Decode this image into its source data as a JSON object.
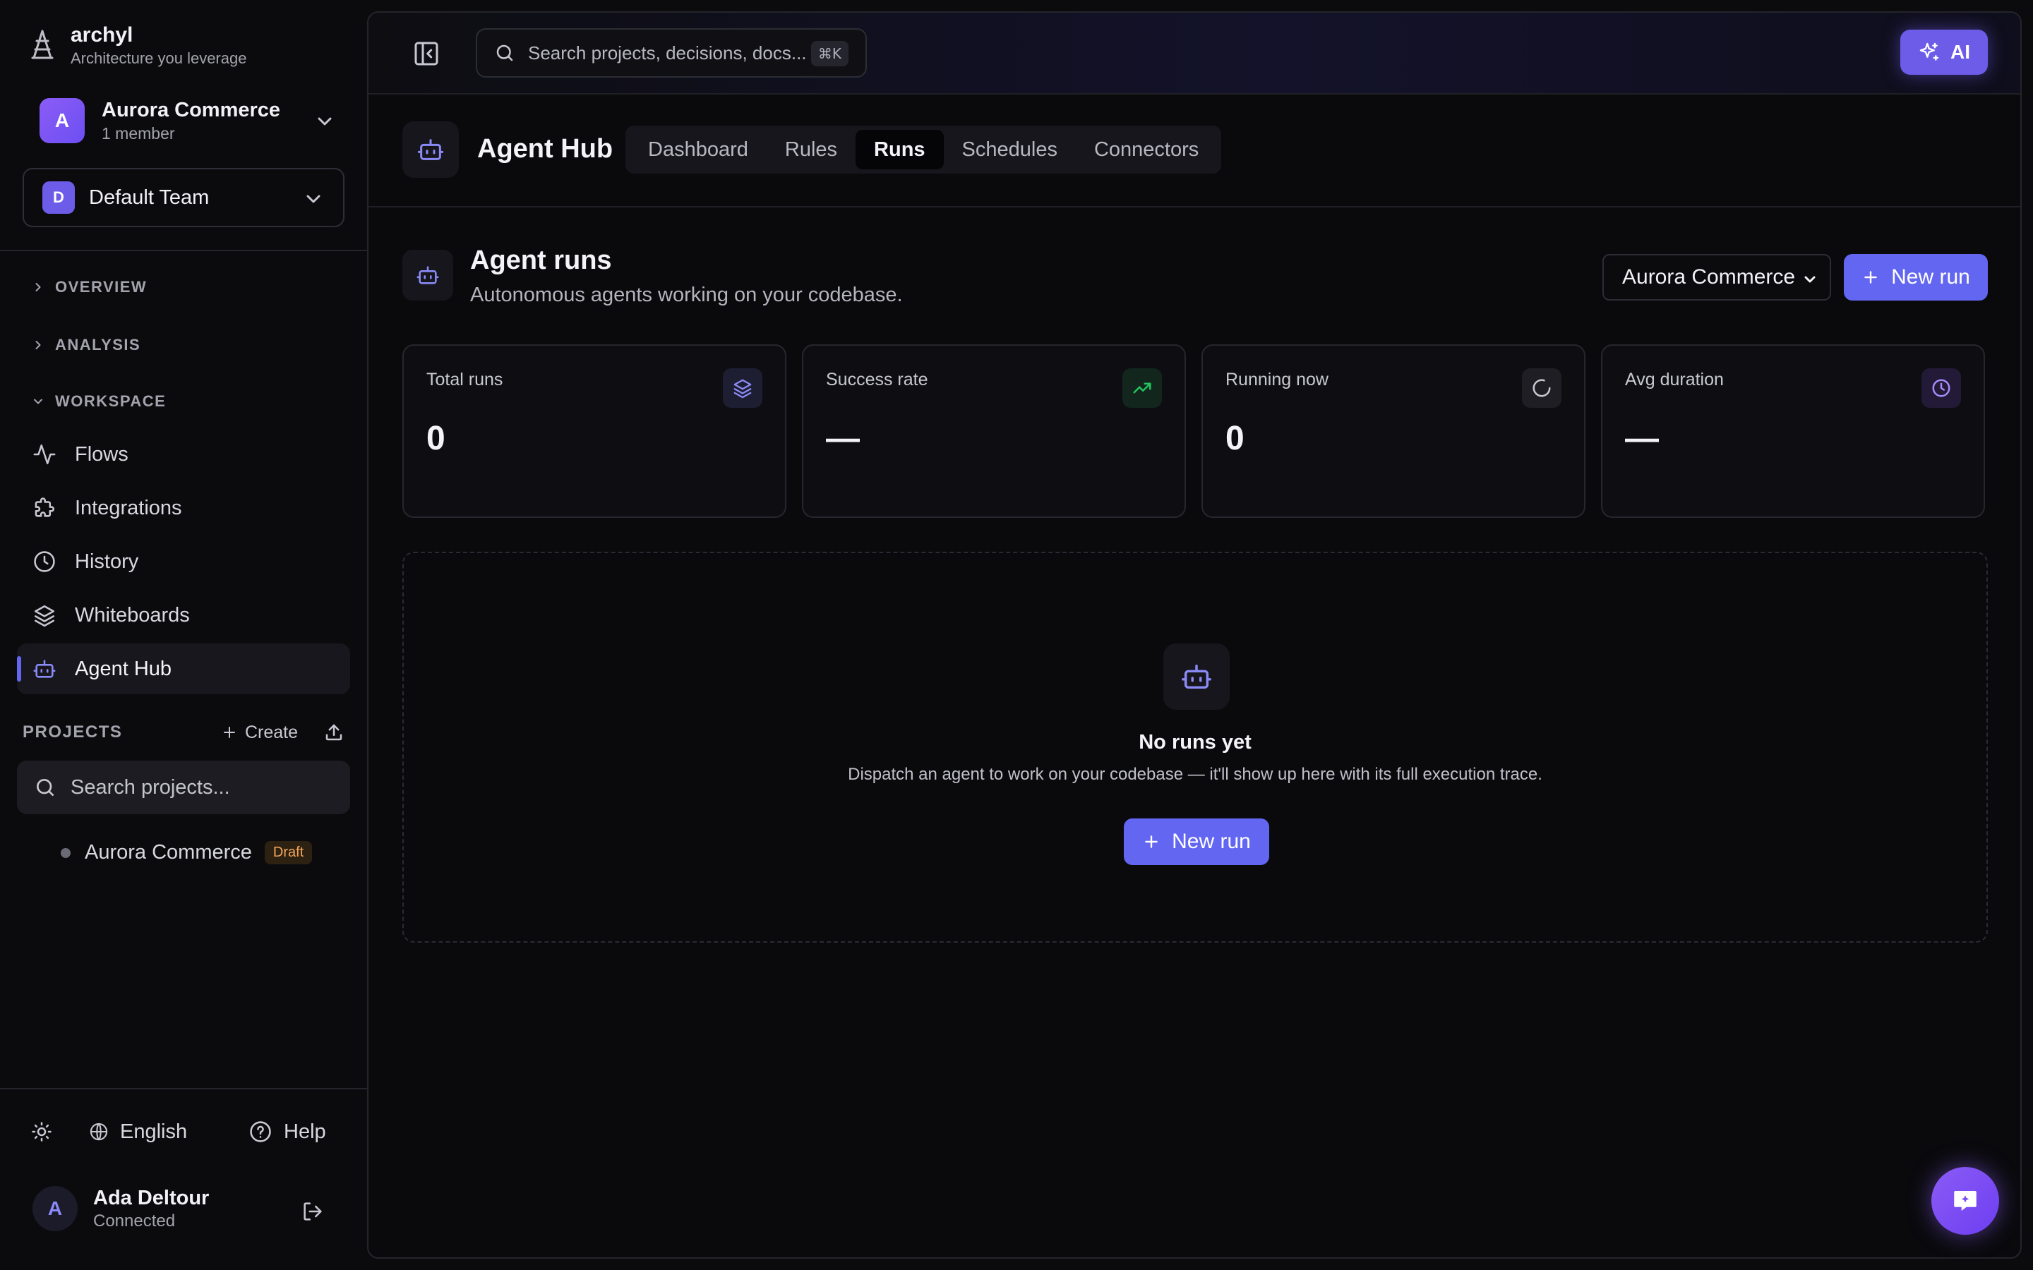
{
  "brand": {
    "name": "archyl",
    "tagline": "Architecture you leverage"
  },
  "org": {
    "avatar": "A",
    "name": "Aurora Commerce",
    "members": "1 member"
  },
  "team": {
    "avatar": "D",
    "name": "Default Team"
  },
  "sections": {
    "overview": "OVERVIEW",
    "analysis": "ANALYSIS",
    "workspace": "WORKSPACE"
  },
  "nav": {
    "flows": "Flows",
    "integrations": "Integrations",
    "history": "History",
    "whiteboards": "Whiteboards",
    "agent_hub": "Agent Hub"
  },
  "projects": {
    "title": "PROJECTS",
    "create": "Create",
    "search_placeholder": "Search projects...",
    "items": [
      {
        "name": "Aurora Commerce",
        "badge": "Draft"
      }
    ]
  },
  "footer": {
    "language": "English",
    "help": "Help"
  },
  "user": {
    "avatar": "A",
    "name": "Ada Deltour",
    "status": "Connected"
  },
  "topbar": {
    "search_placeholder": "Search projects, decisions, docs...",
    "shortcut": "⌘K",
    "ai_label": "AI"
  },
  "hub": {
    "title": "Agent Hub",
    "tabs": [
      "Dashboard",
      "Rules",
      "Runs",
      "Schedules",
      "Connectors"
    ],
    "active_tab": "Runs"
  },
  "runs": {
    "title": "Agent runs",
    "subtitle": "Autonomous agents working on your codebase.",
    "project_select": "Aurora Commerce",
    "new_run": "New run"
  },
  "stats": [
    {
      "label": "Total runs",
      "value": "0",
      "icon": "layers-icon"
    },
    {
      "label": "Success rate",
      "value": "—",
      "icon": "trending-up-icon"
    },
    {
      "label": "Running now",
      "value": "0",
      "icon": "spinner-icon"
    },
    {
      "label": "Avg duration",
      "value": "—",
      "icon": "clock-icon"
    }
  ],
  "empty": {
    "title": "No runs yet",
    "description": "Dispatch an agent to work on your codebase — it'll show up here with its full execution trace.",
    "button": "New run"
  },
  "colors": {
    "accent": "#6366f1",
    "ai": "#6c5ce7",
    "success": "#22c55e",
    "draft": "#f5a65b"
  }
}
